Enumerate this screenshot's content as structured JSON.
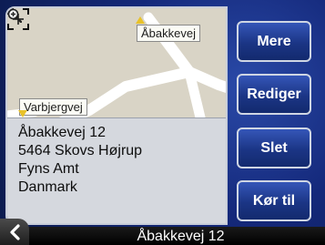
{
  "map": {
    "label_north": "Åbakkevej",
    "label_west": "Varbjergvej"
  },
  "address": {
    "line1": "Åbakkevej 12",
    "line2": "5464 Skovs Højrup",
    "line3": "Fyns Amt",
    "line4": "Danmark"
  },
  "buttons": {
    "more": "Mere",
    "edit": "Rediger",
    "delete": "Slet",
    "drive": "Kør til"
  },
  "bottom_bar": {
    "title": "Åbakkevej 12"
  },
  "icons": {
    "back": "chevron-left-icon",
    "zoom": "zoom-in-icon",
    "crosshair": "crosshair-icon",
    "flag": "flag-icon"
  },
  "colors": {
    "map_background": "#d9d4c6",
    "road": "#ffffff",
    "button_blue": "#1b3585",
    "background_blue": "#14287a",
    "marker_yellow": "#e8c22a"
  }
}
